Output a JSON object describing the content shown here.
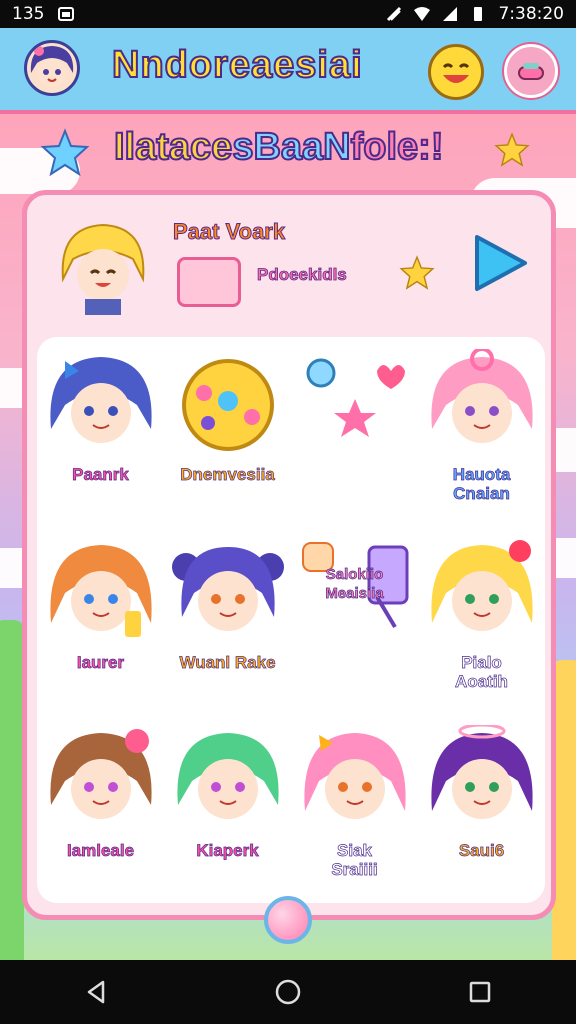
{
  "status_bar": {
    "left_text": "135",
    "time": "7:38:20",
    "icons": [
      "gallery-icon",
      "signal-muted-icon",
      "wifi-icon",
      "cell-signal-icon",
      "battery-icon"
    ]
  },
  "header": {
    "title": "Nndoreaesiai",
    "avatar": "character-avatar",
    "emoji": "smiley-icon",
    "profile": "mask-icon"
  },
  "banner": {
    "part1": "Ilatace",
    "part2": "sBaaN",
    "part3": "fole:!"
  },
  "featured": {
    "title": "Paat Voark",
    "subtitle": "Pdoeekidls",
    "play": "play-icon"
  },
  "grid": [
    {
      "label": "Paanrk",
      "color": "#ff4fa0"
    },
    {
      "label": "Dnemvesiia",
      "color": "#ffb11a"
    },
    {
      "label": "",
      "color": "#ff4fa0"
    },
    {
      "label": "Hauota\nCnaian",
      "color": "#58a9ff"
    },
    {
      "label": "Iaurer",
      "color": "#ff4fa0"
    },
    {
      "label": "Wuanl Rake",
      "color": "#ffb11a"
    },
    {
      "label": "Salokiio\nMeaisiia",
      "color": "#ff7fb1"
    },
    {
      "label": "Pialo\nAoatih",
      "color": "#ffffff"
    },
    {
      "label": "Iamleale",
      "color": "#ff4fa0"
    },
    {
      "label": "Kiaperk",
      "color": "#ff4fa0"
    },
    {
      "label": "Siak\nSraiiii",
      "color": "#ffffff"
    },
    {
      "label": "Saui6",
      "color": "#ffb11a"
    }
  ],
  "nav": {
    "back": "back-icon",
    "home": "home-icon",
    "recent": "recents-icon"
  }
}
